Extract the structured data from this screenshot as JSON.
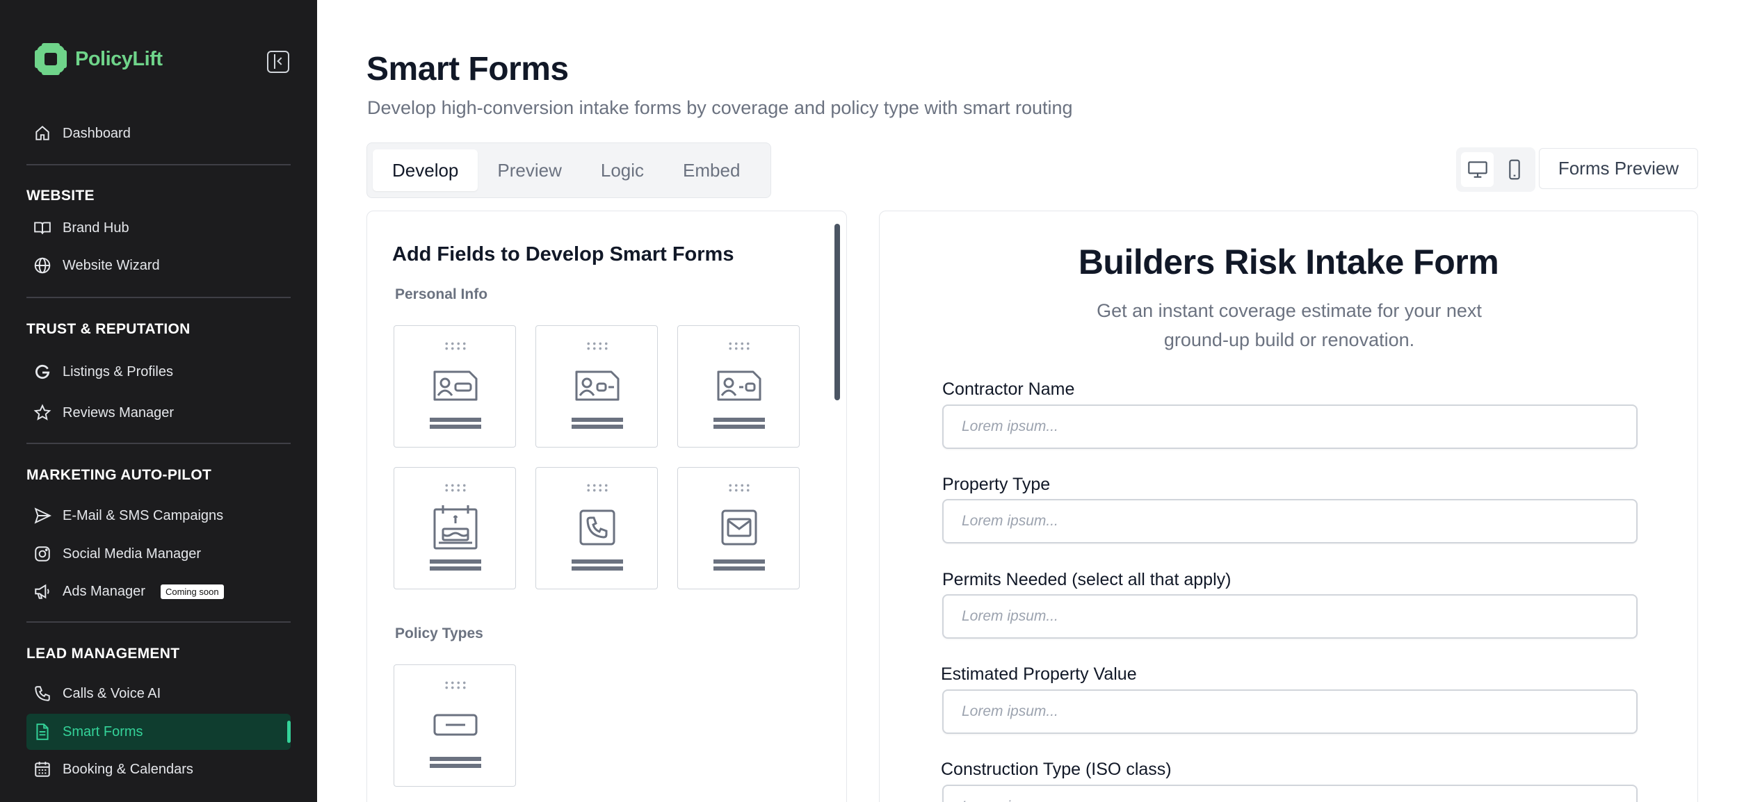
{
  "brand": {
    "name": "PolicyLift",
    "color": "#6fd48a"
  },
  "sidebar": {
    "dashboard": "Dashboard",
    "sections": {
      "website": "WEBSITE",
      "trust": "TRUST & REPUTATION",
      "marketing": "MARKETING AUTO-PILOT",
      "lead": "LEAD MANAGEMENT"
    },
    "items": {
      "brand_hub": "Brand Hub",
      "website_wizard": "Website Wizard",
      "listings": "Listings & Profiles",
      "reviews": "Reviews Manager",
      "email_sms": "E-Mail & SMS Campaigns",
      "social": "Social Media Manager",
      "ads": "Ads Manager",
      "ads_badge": "Coming soon",
      "calls": "Calls & Voice AI",
      "smart_forms": "Smart Forms",
      "booking": "Booking & Calendars"
    }
  },
  "page": {
    "title": "Smart Forms",
    "subtitle": "Develop high-conversion intake forms by coverage and policy type with smart routing"
  },
  "tabs": [
    "Develop",
    "Preview",
    "Logic",
    "Embed"
  ],
  "active_tab": "Develop",
  "toolbar": {
    "forms_preview": "Forms Preview"
  },
  "fields_panel": {
    "title": "Add Fields to Develop Smart Forms",
    "groups": {
      "personal": "Personal Info",
      "policy": "Policy Types"
    },
    "personal_fields": [
      "id-card-name-icon",
      "id-card-dash-icon",
      "id-card-line-icon",
      "birthday-cake-icon",
      "phone-icon",
      "mail-icon"
    ],
    "policy_fields": [
      "text-field-icon"
    ]
  },
  "form": {
    "title": "Builders Risk Intake Form",
    "subtitle": "Get an instant coverage estimate for your next ground-up build or renovation.",
    "placeholder": "Lorem ipsum...",
    "fields": [
      "Contractor Name",
      "Property Type",
      "Permits Needed (select all that apply)",
      "Estimated Property Value",
      "Construction Type (ISO class)"
    ]
  },
  "colors": {
    "sidebar_bg": "#1c1c1e",
    "accent": "#34d399",
    "active_bg": "#0f3d2f"
  }
}
